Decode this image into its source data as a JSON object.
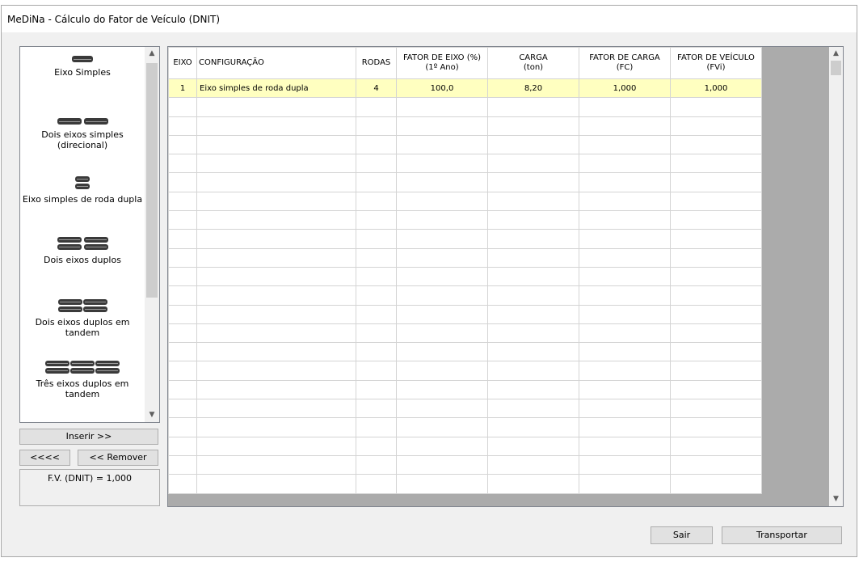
{
  "window": {
    "title": "MeDiNa - Cálculo do Fator de Veículo (DNIT)"
  },
  "axle_types": [
    {
      "label": "Eixo Simples"
    },
    {
      "label": "Dois eixos simples\n(direcional)"
    },
    {
      "label": "Eixo simples de roda dupla"
    },
    {
      "label": "Dois eixos duplos"
    },
    {
      "label": "Dois eixos duplos em\ntandem"
    },
    {
      "label": "Três eixos duplos em\ntandem"
    }
  ],
  "buttons": {
    "inserir": "Inserir >>",
    "back": "<<<<",
    "remover": "<< Remover",
    "sair": "Sair",
    "transportar": "Transportar"
  },
  "result": {
    "text": "F.V. (DNIT) = 1,000"
  },
  "grid": {
    "columns": [
      {
        "label": "EIXO"
      },
      {
        "label": "CONFIGURAÇÃO"
      },
      {
        "label": "RODAS"
      },
      {
        "label": "FATOR DE EIXO (%)\n(1º Ano)"
      },
      {
        "label": "CARGA\n(ton)"
      },
      {
        "label": "FATOR DE CARGA\n(FC)"
      },
      {
        "label": "FATOR DE VEÍCULO\n(FVi)"
      }
    ],
    "rows": [
      {
        "eixo": "1",
        "configuracao": "Eixo simples de roda dupla",
        "rodas": "4",
        "fator_eixo": "100,0",
        "carga": "8,20",
        "fc": "1,000",
        "fvi": "1,000"
      }
    ],
    "empty_row_count": 21
  },
  "scroll_icons": {
    "up": "chevron-up-icon",
    "down": "chevron-down-icon"
  }
}
